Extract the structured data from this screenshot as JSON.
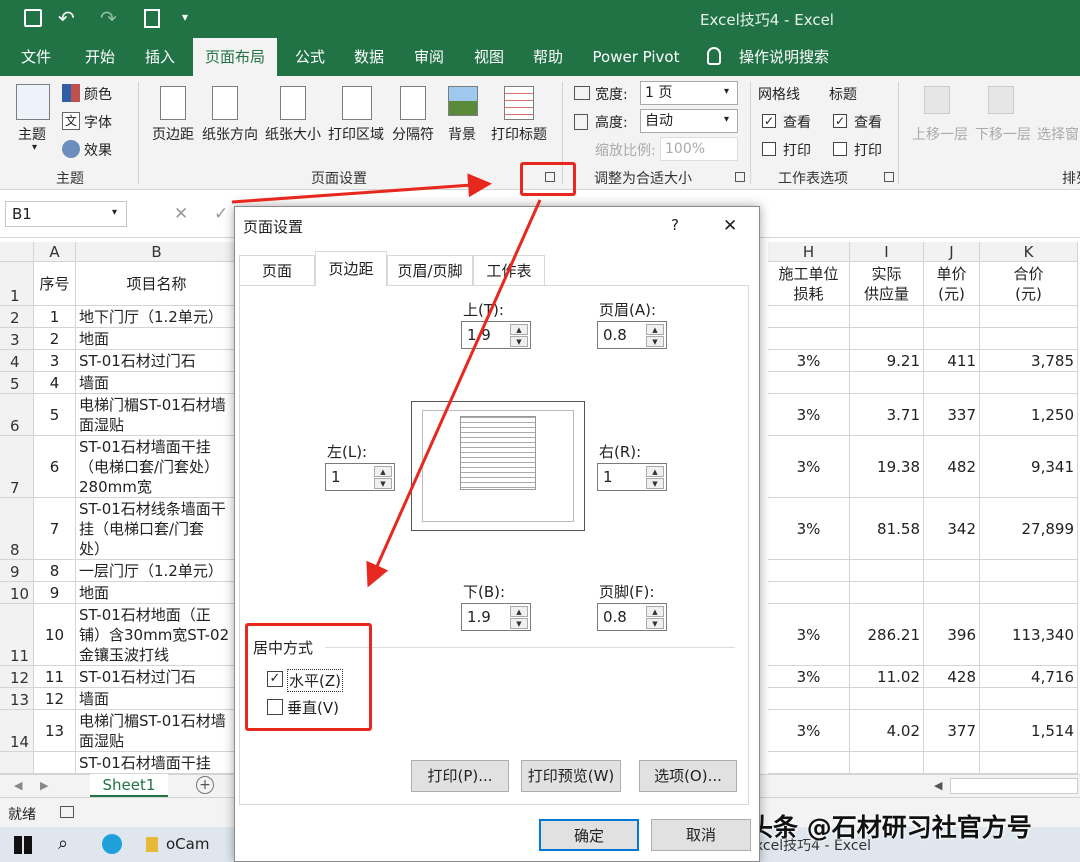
{
  "title": "Excel技巧4  -  Excel",
  "tabs": [
    "文件",
    "开始",
    "插入",
    "页面布局",
    "公式",
    "数据",
    "审阅",
    "视图",
    "帮助",
    "Power Pivot",
    "操作说明搜索"
  ],
  "ribbon": {
    "theme": {
      "main": "主题",
      "colors": "颜色",
      "fonts": "字体",
      "effects": "效果",
      "group": "主题"
    },
    "page_setup": {
      "margins": "页边距",
      "orientation": "纸张方向",
      "size": "纸张大小",
      "print_area": "打印区域",
      "breaks": "分隔符",
      "background": "背景",
      "print_titles": "打印标题",
      "group": "页面设置"
    },
    "scale": {
      "width_label": "宽度:",
      "width_value": "1 页",
      "height_label": "高度:",
      "height_value": "自动",
      "scale_label": "缩放比例:",
      "scale_value": "100%",
      "group": "调整为合适大小"
    },
    "sheet_opts": {
      "gridlines": "网格线",
      "headings": "标题",
      "view": "查看",
      "print": "打印",
      "group": "工作表选项"
    },
    "arrange": {
      "forward": "上移一层",
      "backward": "下移一层",
      "pane": "选择窗",
      "group": "排列"
    }
  },
  "namebox": "B1",
  "formula": "项目名称",
  "columns": [
    "A",
    "B",
    "H",
    "I",
    "J",
    "K"
  ],
  "header_row": {
    "num": "1",
    "a": "序号",
    "b": "项目名称",
    "h": "施工单位\n损耗",
    "i": "实际\n供应量",
    "j": "单价\n(元)",
    "k": "合价\n(元)"
  },
  "rows": [
    {
      "n": "2",
      "a": "1",
      "b": "地下门厅（1.2单元）",
      "h": "",
      "i": "",
      "j": "",
      "k": ""
    },
    {
      "n": "3",
      "a": "2",
      "b": "地面",
      "h": "",
      "i": "",
      "j": "",
      "k": ""
    },
    {
      "n": "4",
      "a": "3",
      "b": "ST-01石材过门石",
      "h": "3%",
      "i": "9.21",
      "j": "411",
      "k": "3,785"
    },
    {
      "n": "5",
      "a": "4",
      "b": "墙面",
      "h": "",
      "i": "",
      "j": "",
      "k": ""
    },
    {
      "n": "6",
      "a": "5",
      "b": "电梯门楣ST-01石材墙\n面湿贴",
      "h": "3%",
      "i": "3.71",
      "j": "337",
      "k": "1,250"
    },
    {
      "n": "7",
      "a": "6",
      "b": "ST-01石材墙面干挂\n（电梯口套/门套处）\n280mm宽",
      "h": "3%",
      "i": "19.38",
      "j": "482",
      "k": "9,341"
    },
    {
      "n": "8",
      "a": "7",
      "b": "ST-01石材线条墙面干\n挂（电梯口套/门套\n处）",
      "h": "3%",
      "i": "81.58",
      "j": "342",
      "k": "27,899"
    },
    {
      "n": "9",
      "a": "8",
      "b": "一层门厅（1.2单元）",
      "h": "",
      "i": "",
      "j": "",
      "k": ""
    },
    {
      "n": "10",
      "a": "9",
      "b": "地面",
      "h": "",
      "i": "",
      "j": "",
      "k": ""
    },
    {
      "n": "11",
      "a": "10",
      "b": "ST-01石材地面（正\n铺）含30mm宽ST-02\n金镶玉波打线",
      "h": "3%",
      "i": "286.21",
      "j": "396",
      "k": "113,340"
    },
    {
      "n": "12",
      "a": "11",
      "b": "ST-01石材过门石",
      "h": "3%",
      "i": "11.02",
      "j": "428",
      "k": "4,716"
    },
    {
      "n": "13",
      "a": "12",
      "b": "墙面",
      "h": "",
      "i": "",
      "j": "",
      "k": ""
    },
    {
      "n": "14",
      "a": "13",
      "b": "电梯门楣ST-01石材墙\n面湿贴",
      "h": "3%",
      "i": "4.02",
      "j": "377",
      "k": "1,514"
    },
    {
      "n": "",
      "a": "",
      "b": "ST-01石材墙面干挂",
      "h": "",
      "i": "",
      "j": "",
      "k": ""
    }
  ],
  "dialog": {
    "title": "页面设置",
    "help": "?",
    "close": "✕",
    "tabs": [
      "页面",
      "页边距",
      "页眉/页脚",
      "工作表"
    ],
    "top_label": "上(T):",
    "top": "1.9",
    "header_label": "页眉(A):",
    "header": "0.8",
    "left_label": "左(L):",
    "left": "1",
    "right_label": "右(R):",
    "right": "1",
    "bottom_label": "下(B):",
    "bottom": "1.9",
    "footer_label": "页脚(F):",
    "footer": "0.8",
    "center_title": "居中方式",
    "horizontal": "水平(Z)",
    "vertical": "垂直(V)",
    "print": "打印(P)...",
    "preview": "打印预览(W)",
    "options": "选项(O)...",
    "ok": "确定",
    "cancel": "取消"
  },
  "sheet_tab": "Sheet1",
  "status": "就绪",
  "taskbar": {
    "ocam": "oCam",
    "excel": "Excel技巧4 - Excel"
  },
  "watermark": "头条 @石材研习社官方号"
}
